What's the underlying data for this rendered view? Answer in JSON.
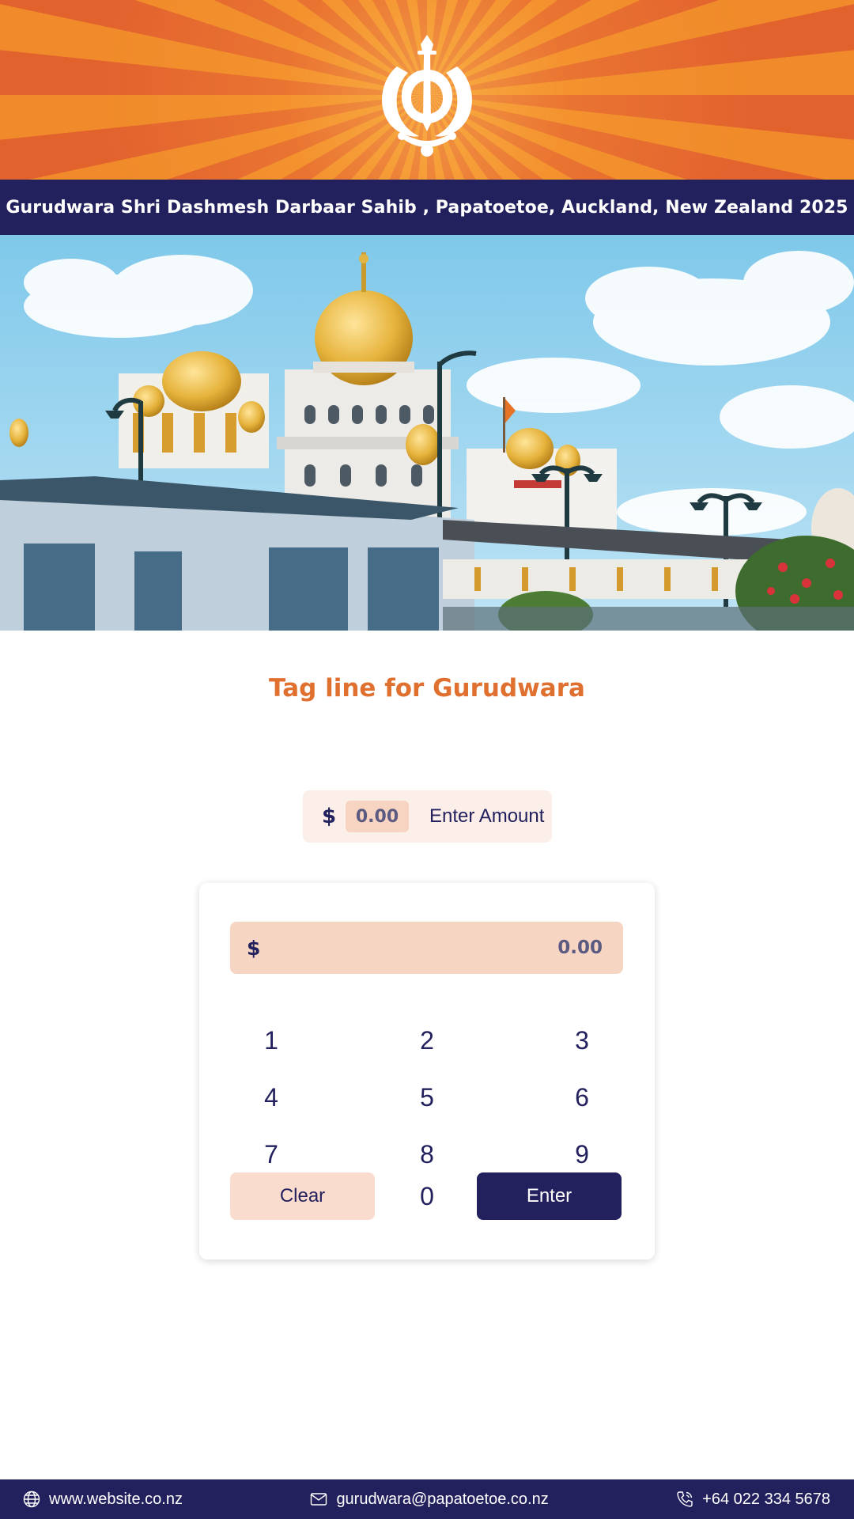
{
  "header": {
    "logo_icon": "khanda-icon",
    "title": "Gurudwara Shri Dashmesh Darbaar Sahib , Papatoetoe, Auckland, New Zealand 2025",
    "colors": {
      "banner_orange": "#f08a2a",
      "banner_dark_orange": "#e2622e",
      "navy": "#22215e"
    }
  },
  "hero": {
    "image": "gurudwara-temple-photo"
  },
  "tagline": "Tag line for Gurudwara",
  "amount_pill": {
    "currency": "$",
    "value": "0.00",
    "label": "Enter Amount"
  },
  "keypad": {
    "display_currency": "$",
    "display_value": "0.00",
    "keys": [
      "1",
      "2",
      "3",
      "4",
      "5",
      "6",
      "7",
      "8",
      "9",
      "0"
    ],
    "clear_label": "Clear",
    "enter_label": "Enter"
  },
  "footer": {
    "website": "www.website.co.nz",
    "email": "gurudwara@papatoetoe.co.nz",
    "phone": "+64 022 334 5678",
    "icons": [
      "globe-icon",
      "mail-icon",
      "phone-icon"
    ]
  }
}
